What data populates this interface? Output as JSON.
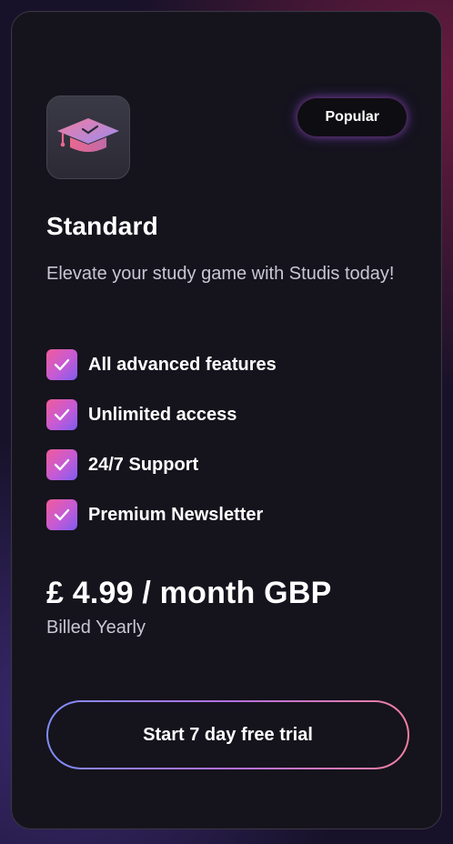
{
  "plan": {
    "badge": "Popular",
    "title": "Standard",
    "description": "Elevate your study game with Studis today!",
    "icon": "graduation-cap-icon",
    "features": [
      {
        "label": "All advanced features",
        "icon": "check-icon"
      },
      {
        "label": "Unlimited access",
        "icon": "check-icon"
      },
      {
        "label": "24/7 Support",
        "icon": "check-icon"
      },
      {
        "label": "Premium Newsletter",
        "icon": "check-icon"
      }
    ],
    "price": "£ 4.99 / month GBP",
    "billing": "Billed Yearly",
    "cta_label": "Start 7 day free trial"
  },
  "colors": {
    "card_background": "#15131c",
    "page_background": "#171229",
    "accent_pink": "#f15b9a",
    "accent_purple": "#7e5cf0",
    "text_primary": "#ffffff",
    "text_secondary": "#c9c7d4"
  }
}
